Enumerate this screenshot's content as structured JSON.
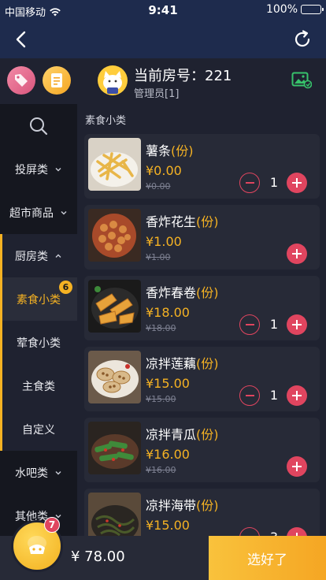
{
  "status": {
    "carrier": "中国移动",
    "time": "9:41",
    "battery": "100%",
    "battery_level": 1.0
  },
  "header": {
    "room_label": "当前房号：221",
    "role": "管理员[1]"
  },
  "sidebar": {
    "categories": [
      {
        "label": "投屏类",
        "chevron": "down"
      },
      {
        "label": "超市商品",
        "chevron": "down"
      },
      {
        "label": "厨房类",
        "chevron": "up"
      }
    ],
    "subcategories": [
      {
        "label": "素食小类",
        "badge": "6",
        "active": true
      },
      {
        "label": "荤食小类"
      },
      {
        "label": "主食类"
      },
      {
        "label": "自定义"
      }
    ],
    "more": [
      {
        "label": "水吧类",
        "chevron": "down"
      },
      {
        "label": "其他类",
        "chevron": "down"
      }
    ]
  },
  "section_title": "素食小类",
  "products": [
    {
      "name": "薯条",
      "unit": "(份)",
      "price": "¥0.00",
      "old_price": "¥0.00",
      "qty": "1",
      "food": "fries"
    },
    {
      "name": "香炸花生",
      "unit": "(份)",
      "price": "¥1.00",
      "old_price": "¥1.00",
      "qty": "",
      "food": "peanut"
    },
    {
      "name": "香炸春卷",
      "unit": "(份)",
      "price": "¥18.00",
      "old_price": "¥18.00",
      "qty": "1",
      "food": "springroll"
    },
    {
      "name": "凉拌莲藕",
      "unit": "(份)",
      "price": "¥15.00",
      "old_price": "¥15.00",
      "qty": "1",
      "food": "lotus"
    },
    {
      "name": "凉拌青瓜",
      "unit": "(份)",
      "price": "¥16.00",
      "old_price": "¥16.00",
      "qty": "",
      "food": "cucumber"
    },
    {
      "name": "凉拌海带",
      "unit": "(份)",
      "price": "¥15.00",
      "old_price": "",
      "qty": "3",
      "food": "seaweed"
    }
  ],
  "cart": {
    "count": "7",
    "total": "¥ 78.00",
    "confirm_label": "选好了"
  },
  "colors": {
    "accent": "#f5b223",
    "minus_plus": "#e0455f",
    "nav": "#1e2b4d"
  }
}
